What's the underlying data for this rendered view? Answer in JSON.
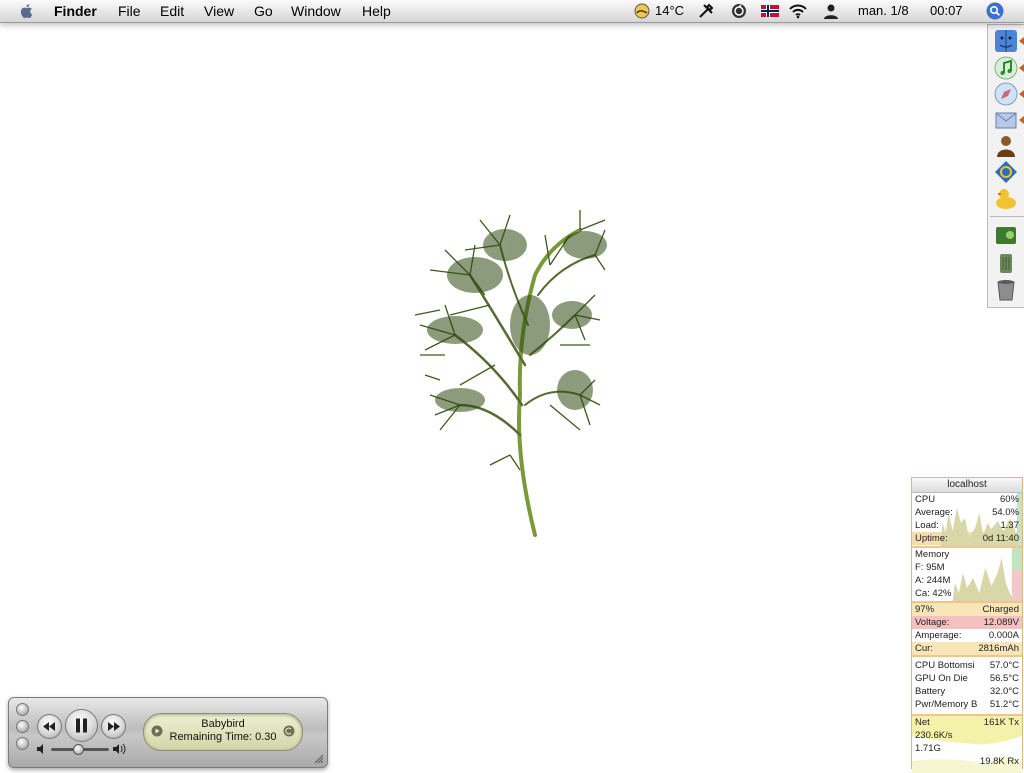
{
  "menubar": {
    "app_name": "Finder",
    "menus": [
      "File",
      "Edit",
      "View",
      "Go",
      "Window",
      "Help"
    ],
    "status": {
      "weather_temp": "14°C",
      "date": "man. 1/8",
      "time": "00:07"
    }
  },
  "dock": {
    "icons": [
      "finder-icon",
      "itunes-icon",
      "safari-icon",
      "mail-icon",
      "user-figure-icon",
      "app-q-icon",
      "rubber-duck-icon",
      "photo-book-icon",
      "trash-can-icon",
      "trash-icon"
    ]
  },
  "monitor": {
    "host": "localhost",
    "cpu": {
      "label": "CPU",
      "value": "60%",
      "average_label": "Average:",
      "average": "54.0%",
      "load_label": "Load:",
      "load": "1.37",
      "uptime_label": "Uptime:",
      "uptime": "0d 11:40"
    },
    "memory": {
      "label": "Memory",
      "free": "F: 95M",
      "active": "A: 244M",
      "cache": "Ca: 42%"
    },
    "battery": {
      "percent": "97%",
      "state": "Charged",
      "voltage_label": "Voltage:",
      "voltage": "12.089V",
      "amperage_label": "Amperage:",
      "amperage": "0.000A",
      "cur_label": "Cur:",
      "cur": "2816mAh"
    },
    "temps": [
      {
        "label": "CPU Bottomsi",
        "value": "57.0°C"
      },
      {
        "label": "GPU On Die",
        "value": "56.5°C"
      },
      {
        "label": "Battery",
        "value": "32.0°C"
      },
      {
        "label": "Pwr/Memory B",
        "value": "51.2°C"
      }
    ],
    "net": {
      "label": "Net",
      "tx": "161K Tx",
      "rate": "230.6K/s",
      "total": "1.71G",
      "rx": "19.8K Rx"
    }
  },
  "player": {
    "track": "Babybird",
    "remaining": "Remaining Time: 0.30",
    "volume_level": 0.45
  },
  "colors": {
    "accent": "#f0c48a",
    "battery_alert": "#f4c0c0",
    "lcd": "#e3e6bd"
  }
}
